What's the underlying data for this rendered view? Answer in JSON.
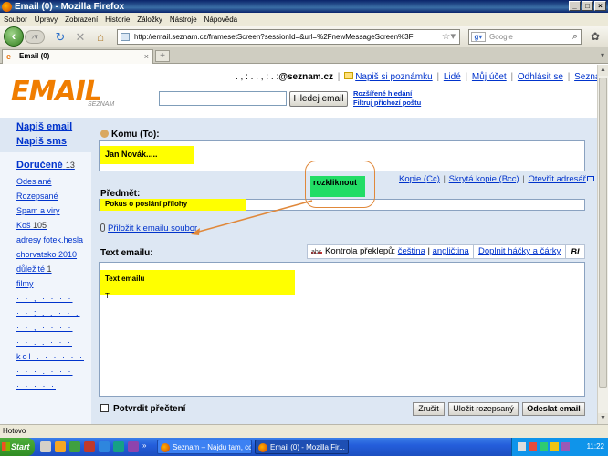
{
  "window": {
    "title": "Email (0) - Mozilla Firefox"
  },
  "menu": [
    "Soubor",
    "Úpravy",
    "Zobrazení",
    "Historie",
    "Záložky",
    "Nástroje",
    "Nápověda"
  ],
  "nav": {
    "url": "http://email.seznam.cz/framesetScreen?sessionId=&url=%2FnewMessageScreen%3F",
    "search_placeholder": "Google"
  },
  "tab": {
    "label": "Email (0)"
  },
  "header": {
    "logo_text": "EMAIL",
    "logo_sub": "SEZNAM",
    "user_masked": ". , : . . , : . :",
    "user_domain": "@seznam.cz",
    "links": [
      "Napiš si poznámku",
      "Lidé",
      "Můj účet",
      "Odhlásit se",
      "Seznam"
    ],
    "search_button": "Hledej email",
    "adv_search": "Rozšířené hledání",
    "filter": "Filtruj příchozí poštu"
  },
  "sidebar": {
    "compose_email": "Napiš email",
    "compose_sms": "Napiš sms",
    "folders": [
      {
        "label": "Doručené",
        "count": "13",
        "bold": true
      },
      {
        "label": "Odeslané",
        "count": ""
      },
      {
        "label": "Rozepsané",
        "count": ""
      },
      {
        "label": "Spam a viry",
        "count": ""
      },
      {
        "label": "Koš",
        "count": "105"
      },
      {
        "label": "adresy fotek.hesla",
        "count": ""
      },
      {
        "label": "chorvatsko 2010",
        "count": ""
      },
      {
        "label": "důležité",
        "count": "1"
      },
      {
        "label": "filmy",
        "count": ""
      }
    ],
    "masked_rows": [
      "· · , · ·  · ·",
      "· · ; . . · · ,",
      "· · , · · · ·",
      "· · . . · · ·",
      "kol . · · · · ·",
      "· · · . · · ·",
      "· · · · ·"
    ]
  },
  "compose": {
    "to_label": "Komu (To):",
    "to_value": "Jan Novák.....",
    "cc_links": [
      "Kopie (Cc)",
      "Skrytá kopie (Bcc)",
      "Otevřít adresář"
    ],
    "subject_label": "Předmět:",
    "subject_value": "Pokus o poslání přílohy",
    "callout": "rozkliknout",
    "attach_link": "Přiložit k emailu soubor",
    "text_label": "Text emailu:",
    "spell_label": "Kontrola překlepů:",
    "spell_langs": [
      "čeština",
      "angličtina"
    ],
    "diacritics": "Doplnit háčky a čárky",
    "format_btn": "BI",
    "body_value": "Text emailu",
    "body_caret": "T",
    "confirm_label": "Potvrdit přečtení",
    "btn_cancel": "Zrušit",
    "btn_save": "Uložit rozepsaný",
    "btn_send": "Odeslat email"
  },
  "status": {
    "text": "Hotovo"
  },
  "taskbar": {
    "start": "Start",
    "tasks": [
      "Seznam – Najdu tam, co ...",
      "Email (0) - Mozilla Fir..."
    ],
    "clock": "11:22"
  }
}
